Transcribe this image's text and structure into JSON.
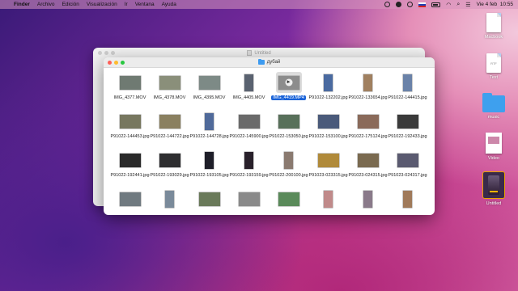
{
  "menubar": {
    "app": "Finder",
    "menus": [
      "Archivo",
      "Edición",
      "Visualización",
      "Ir",
      "Ventana",
      "Ayuda"
    ],
    "clock": "Vie 4 feb  10:55"
  },
  "back_window": {
    "title": "Untitled"
  },
  "window": {
    "title": "дубай",
    "items": [
      {
        "label": "IMG_4377.MOV",
        "shape": "land",
        "color": "#6f7a72",
        "selected": false
      },
      {
        "label": "IMG_4378.MOV",
        "shape": "land",
        "color": "#8a8f7a",
        "selected": false
      },
      {
        "label": "IMG_4395.MOV",
        "shape": "land",
        "color": "#7d8a86",
        "selected": false
      },
      {
        "label": "IMG_4405.MOV",
        "shape": "port",
        "color": "#5a6270",
        "selected": false
      },
      {
        "label": "IMG_4419.MP4",
        "shape": "land",
        "color": "#8c8c8c",
        "selected": true
      },
      {
        "label": "P91022-132202.jpg",
        "shape": "port",
        "color": "#4a6aa0",
        "selected": false
      },
      {
        "label": "P91022-133654.jpg",
        "shape": "port",
        "color": "#a08060",
        "selected": false
      },
      {
        "label": "P91022-144415.jpg",
        "shape": "port",
        "color": "#6a82a8",
        "selected": false
      },
      {
        "label": "P91022-144453.jpg",
        "shape": "land",
        "color": "#77775f",
        "selected": false
      },
      {
        "label": "P91022-144722.jpg",
        "shape": "land",
        "color": "#8a8060",
        "selected": false
      },
      {
        "label": "P91022-144728.jpg",
        "shape": "port",
        "color": "#506a9a",
        "selected": false
      },
      {
        "label": "P91022-145900.jpg",
        "shape": "land",
        "color": "#6a6a6a",
        "selected": false
      },
      {
        "label": "P91022-153050.jpg",
        "shape": "land",
        "color": "#58705a",
        "selected": false
      },
      {
        "label": "P91022-153100.jpg",
        "shape": "land",
        "color": "#4a5a7a",
        "selected": false
      },
      {
        "label": "P91022-175124.jpg",
        "shape": "land",
        "color": "#8a6a5a",
        "selected": false
      },
      {
        "label": "P91022-192433.jpg",
        "shape": "land",
        "color": "#3a3a3a",
        "selected": false
      },
      {
        "label": "P91022-192441.jpg",
        "shape": "land",
        "color": "#2a2a2a",
        "selected": false
      },
      {
        "label": "P91022-193029.jpg",
        "shape": "land",
        "color": "#2e2e30",
        "selected": false
      },
      {
        "label": "P91022-193105.jpg",
        "shape": "port",
        "color": "#1e1e28",
        "selected": false
      },
      {
        "label": "P91022-193159.jpg",
        "shape": "port",
        "color": "#28202a",
        "selected": false
      },
      {
        "label": "P91022-200100.jpg",
        "shape": "port",
        "color": "#8a7a70",
        "selected": false
      },
      {
        "label": "P91023-023315.jpg",
        "shape": "land",
        "color": "#b08a3a",
        "selected": false
      },
      {
        "label": "P91023-024315.jpg",
        "shape": "land",
        "color": "#7a6a50",
        "selected": false
      },
      {
        "label": "P91023-024317.jpg",
        "shape": "land",
        "color": "#5a5a70",
        "selected": false
      },
      {
        "label": "",
        "shape": "land",
        "color": "#707a80",
        "selected": false
      },
      {
        "label": "",
        "shape": "port",
        "color": "#7a8a9a",
        "selected": false
      },
      {
        "label": "",
        "shape": "land",
        "color": "#6a7a5a",
        "selected": false
      },
      {
        "label": "",
        "shape": "land",
        "color": "#8a8a8a",
        "selected": false
      },
      {
        "label": "",
        "shape": "land",
        "color": "#5a8a5a",
        "selected": false
      },
      {
        "label": "",
        "shape": "port",
        "color": "#c08a8a",
        "selected": false
      },
      {
        "label": "",
        "shape": "port",
        "color": "#8a7a8a",
        "selected": false
      },
      {
        "label": "",
        "shape": "port",
        "color": "#a07a5a",
        "selected": false
      }
    ]
  },
  "desktop": {
    "items": [
      {
        "label": "Macbook",
        "kind": "doc",
        "ext": ""
      },
      {
        "label": "Text",
        "kind": "doc",
        "ext": "RTF"
      },
      {
        "label": "music",
        "kind": "folder",
        "ext": ""
      },
      {
        "label": "Video",
        "kind": "video",
        "ext": ""
      },
      {
        "label": "Untitled",
        "kind": "drive",
        "ext": ""
      }
    ]
  }
}
